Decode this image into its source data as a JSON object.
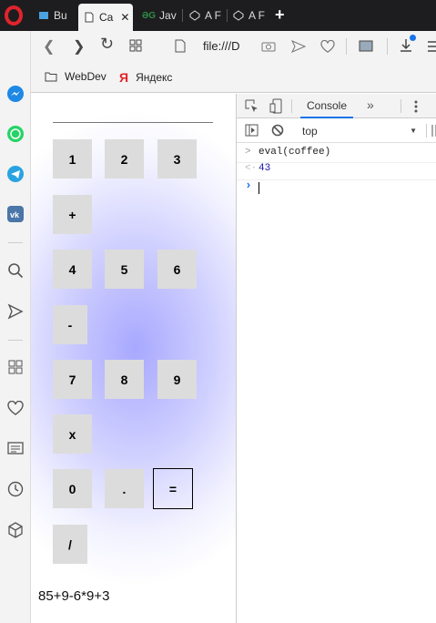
{
  "browser": {
    "tabs": [
      {
        "label": "Bu",
        "active": false
      },
      {
        "label": "Ca",
        "active": true
      },
      {
        "label": "Jav",
        "active": false
      },
      {
        "label": "A F",
        "active": false
      },
      {
        "label": "A F",
        "active": false
      }
    ],
    "tab_close": "✕",
    "new_tab": "+",
    "url": "file:///D",
    "bookmarks": [
      {
        "label": "WebDev",
        "icon": "folder-icon"
      },
      {
        "label": "Яндекс",
        "icon": "yandex-icon"
      }
    ]
  },
  "calculator": {
    "keys": {
      "k1": "1",
      "k2": "2",
      "k3": "3",
      "plus": "+",
      "k4": "4",
      "k5": "5",
      "k6": "6",
      "minus": "-",
      "k7": "7",
      "k8": "8",
      "k9": "9",
      "times": "x",
      "k0": "0",
      "dot": ".",
      "equals": "=",
      "divide": "/"
    },
    "expression": "85+9-6*9+3"
  },
  "devtools": {
    "active_tab": "Console",
    "more_tabs": "»",
    "context": "top",
    "console": [
      {
        "type": "input",
        "text": "eval(coffee)"
      },
      {
        "type": "output",
        "text": "43"
      }
    ],
    "prompt": "›"
  },
  "colors": {
    "accent": "#1a73e8",
    "opera_red": "#e0242c",
    "gradient_center": "#a8a8ff",
    "output_number": "#1a1aa6"
  }
}
